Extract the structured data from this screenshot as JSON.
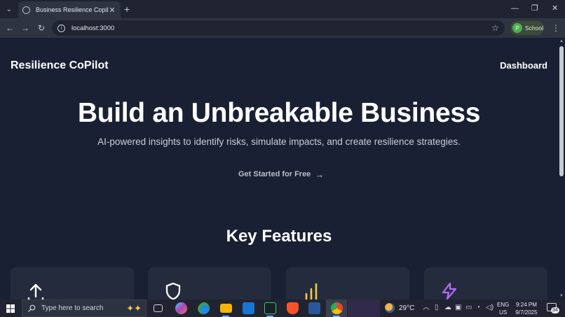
{
  "browser": {
    "tab_title": "Business Resilience Copilot",
    "url": "localhost:3000",
    "profile_initial": "P",
    "profile_name": "School"
  },
  "page": {
    "brand": "Resilience CoPilot",
    "nav_dashboard": "Dashboard",
    "hero_title": "Build an Unbreakable Business",
    "hero_subtitle": "AI-powered insights to identify risks, simulate impacts, and create resilience strategies.",
    "cta_label": "Get Started for Free",
    "features_title": "Key Features",
    "feature_icons": [
      "upload-icon",
      "shield-icon",
      "bar-chart-icon",
      "lightning-icon"
    ]
  },
  "taskbar": {
    "search_placeholder": "Type here to search",
    "temperature": "29°C",
    "lang_top": "ENG",
    "lang_bottom": "US",
    "time": "9:24 PM",
    "date": "9/7/2025",
    "notification_count": "34"
  },
  "colors": {
    "page_bg": "#1a2033",
    "card_bg": "#242b3d",
    "accent_yellow": "#f2c94c",
    "accent_purple": "#b36cff"
  }
}
